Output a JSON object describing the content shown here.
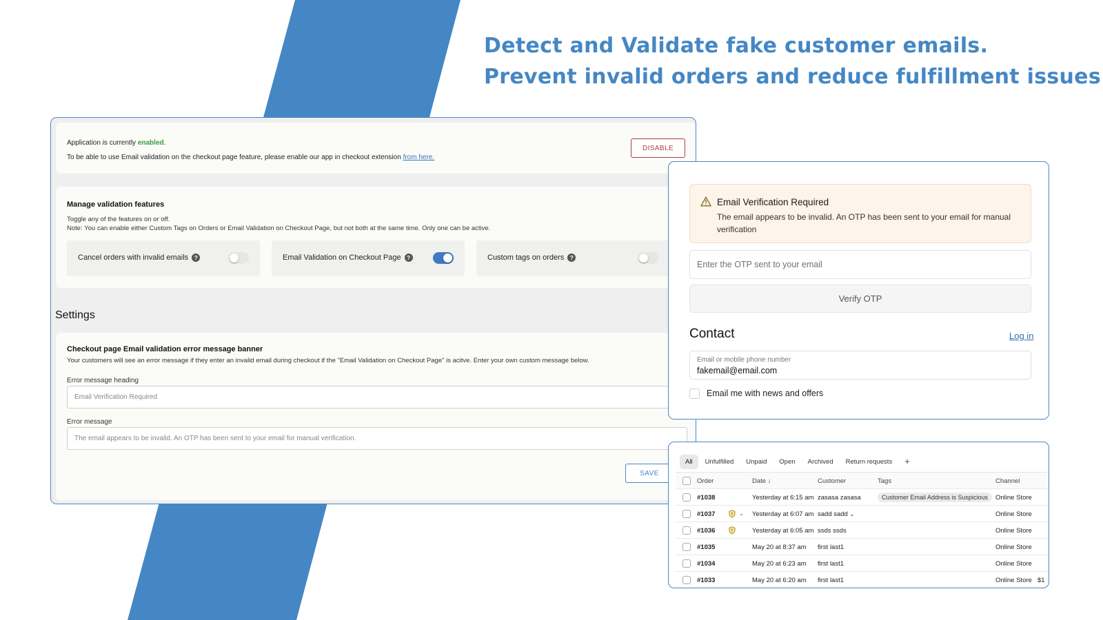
{
  "headline": {
    "line1": "Detect and Validate fake customer emails.",
    "line2": "Prevent invalid orders and reduce fulfillment issues."
  },
  "colors": {
    "accent_blue": "#4587c4",
    "enabled_green": "#3e9a42",
    "disable_red": "#b23a3a"
  },
  "admin": {
    "status": {
      "prefix": "Application is currently ",
      "state": "enabled",
      "suffix": ".",
      "note": "To be able to use Email validation on the checkout page feature, please enable our app in checkout extension ",
      "link": "from here.",
      "disable_label": "DISABLE"
    },
    "features": {
      "title": "Manage validation features",
      "subtitle": "Toggle any of the features on or off.",
      "note": "Note: You can enable either Custom Tags on Orders or Email Validation on Checkout Page, but not both at the same time. Only one can be active.",
      "toggles": [
        {
          "label": "Cancel orders with invalid emails",
          "enabled": false
        },
        {
          "label": "Email Validation on Checkout Page",
          "enabled": true
        },
        {
          "label": "Custom tags on orders",
          "enabled": false
        }
      ]
    },
    "settings": {
      "title": "Settings",
      "banner_heading": "Checkout page Email validation error message banner",
      "banner_desc": "Your customers will see an error message if they enter an invalid email during checkout if the \"Email Validation on Checkout Page\" is acitve. Enter your own custom message below.",
      "heading_label": "Error message heading",
      "heading_value": "Email Verification Required",
      "message_label": "Error message",
      "message_value": "The email appears to be invalid. An OTP has been sent to your email for manual verification.",
      "save_label": "SAVE"
    }
  },
  "checkout": {
    "alert_title": "Email Verification Required",
    "alert_body": "The email appears to be invalid. An OTP has been sent to your email for manual verification",
    "otp_placeholder": "Enter the OTP sent to your email",
    "verify_label": "Verify OTP",
    "contact_title": "Contact",
    "login_label": "Log in",
    "email_label": "Email or mobile phone number",
    "email_value": "fakemail@email.com",
    "newsletter_label": "Email me with news and offers"
  },
  "orders": {
    "tabs": [
      "All",
      "Unfulfilled",
      "Unpaid",
      "Open",
      "Archived",
      "Return requests"
    ],
    "add_tab": "+",
    "columns": {
      "order": "Order",
      "date": "Date ↓",
      "customer": "Customer",
      "tags": "Tags",
      "channel": "Channel"
    },
    "rows": [
      {
        "order": "#1038",
        "date": "Yesterday at 6:15 am",
        "customer": "zasasa zasasa",
        "tag": "Customer Email Address is Suspicious",
        "channel": "Online Store",
        "risk": false,
        "chevron": false,
        "customer_chevron": false
      },
      {
        "order": "#1037",
        "date": "Yesterday at 6:07 am",
        "customer": "sadd sadd",
        "tag": "",
        "channel": "Online Store",
        "risk": true,
        "chevron": true,
        "customer_chevron": true
      },
      {
        "order": "#1036",
        "date": "Yesterday at 6:05 am",
        "customer": "ssds ssds",
        "tag": "",
        "channel": "Online Store",
        "risk": true,
        "chevron": false,
        "customer_chevron": false
      },
      {
        "order": "#1035",
        "date": "May 20 at 8:37 am",
        "customer": "first last1",
        "tag": "",
        "channel": "Online Store",
        "risk": false,
        "chevron": false,
        "customer_chevron": false
      },
      {
        "order": "#1034",
        "date": "May 20 at 6:23 am",
        "customer": "first last1",
        "tag": "",
        "channel": "Online Store",
        "risk": false,
        "chevron": false,
        "customer_chevron": false
      },
      {
        "order": "#1033",
        "date": "May 20 at 6:20 am",
        "customer": "first last1",
        "tag": "",
        "channel": "Online Store",
        "risk": false,
        "chevron": false,
        "customer_chevron": false,
        "extra": "$1"
      }
    ]
  }
}
